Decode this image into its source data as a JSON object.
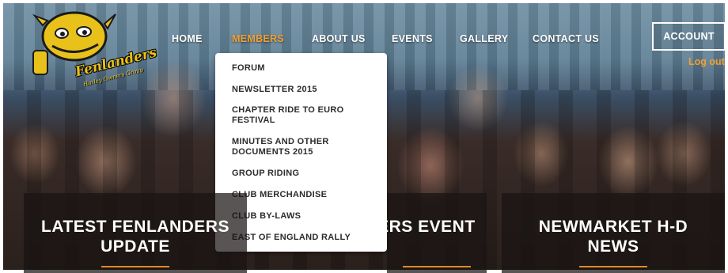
{
  "logo": {
    "name": "Fenlanders",
    "tagline": "Harley Owners Group"
  },
  "nav": {
    "items": [
      {
        "label": "HOME",
        "active": false
      },
      {
        "label": "MEMBERS",
        "active": true
      },
      {
        "label": "ABOUT US",
        "active": false
      },
      {
        "label": "EVENTS",
        "active": false
      },
      {
        "label": "GALLERY",
        "active": false
      },
      {
        "label": "CONTACT US",
        "active": false
      }
    ],
    "account_label": "ACCOUNT",
    "logout_label": "Log out"
  },
  "members_menu": {
    "items": [
      {
        "label": "FORUM"
      },
      {
        "label": "NEWSLETTER 2015"
      },
      {
        "label": "CHAPTER RIDE TO EURO FESTIVAL"
      },
      {
        "label": "MINUTES AND OTHER DOCUMENTS 2015"
      },
      {
        "label": "GROUP RIDING"
      },
      {
        "label": "CLUB MERCHANDISE"
      },
      {
        "label": "CLUB BY-LAWS"
      },
      {
        "label": "EAST OF ENGLAND RALLY"
      }
    ]
  },
  "cards": [
    {
      "title": "LATEST FENLANDERS UPDATE"
    },
    {
      "title": "FENLANDERS EVENT"
    },
    {
      "title": "NEWMARKET H-D NEWS"
    }
  ],
  "colors": {
    "accent": "#f0a030",
    "rule": "#e08a2a",
    "dropdown_text": "#2c2c2c"
  }
}
